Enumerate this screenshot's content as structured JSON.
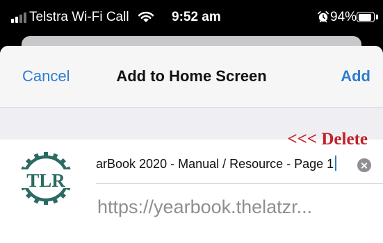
{
  "status_bar": {
    "carrier": "Telstra Wi-Fi Call",
    "time": "9:52 am",
    "battery_percent": "94%",
    "battery_level": 0.94,
    "icons": [
      "signal-icon",
      "wifi-icon",
      "alarm-icon",
      "battery-icon"
    ]
  },
  "nav": {
    "cancel_label": "Cancel",
    "title": "Add to Home Screen",
    "add_label": "Add"
  },
  "annotation": {
    "text": "<<< Delete",
    "color": "#c32026"
  },
  "shortcut": {
    "logo_text": "TLR",
    "logo_color": "#2a6b62",
    "name_value": "arBook 2020 - Manual / Resource - Page 1",
    "url": "https://yearbook.thelatzr..."
  },
  "colors": {
    "accent": "#2f7bd1",
    "nav_background": "#f6f6f7",
    "section_background": "#efeff3",
    "secondary_text": "#8e8e93"
  }
}
